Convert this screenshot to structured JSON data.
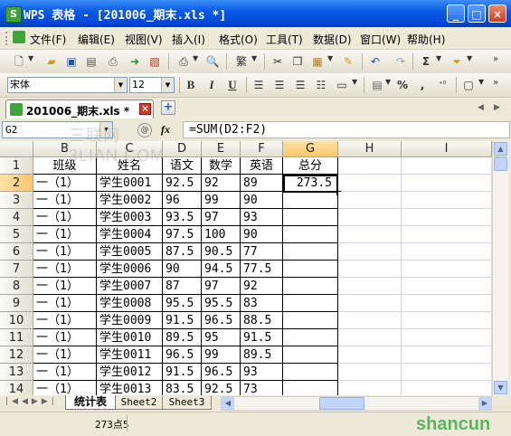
{
  "window": {
    "app_icon": "S",
    "title": "WPS 表格 - [201006_期末.xls *]",
    "min_icon": "_",
    "max_icon": "□",
    "close_icon": "×"
  },
  "menu": {
    "items": [
      "文件(F)",
      "编辑(E)",
      "视图(V)",
      "插入(I)",
      "格式(O)",
      "工具(T)",
      "数据(D)",
      "窗口(W)",
      "帮助(H)"
    ]
  },
  "format_toolbar": {
    "font_name": "宋体",
    "font_size": "12",
    "bold": "B",
    "italic": "I",
    "underline": "U",
    "percent": "%",
    "thousands": ","
  },
  "file_tab": {
    "label": "201006_期末.xls *",
    "add_label": "+"
  },
  "formula_bar": {
    "name_box": "G2",
    "fx": "fx",
    "formula": "=SUM(D2:F2)"
  },
  "columns": [
    "B",
    "C",
    "D",
    "E",
    "F",
    "G",
    "H",
    "I"
  ],
  "rows": [
    {
      "n": "1",
      "b": "班级",
      "c": "姓名",
      "d": "语文",
      "e": "数学",
      "f": "英语",
      "g": "总分"
    },
    {
      "n": "2",
      "b": "一（1）",
      "c": "学生0001",
      "d": "92.5",
      "e": "92",
      "f": "89",
      "g": "273.5"
    },
    {
      "n": "3",
      "b": "一（1）",
      "c": "学生0002",
      "d": "96",
      "e": "99",
      "f": "90",
      "g": ""
    },
    {
      "n": "4",
      "b": "一（1）",
      "c": "学生0003",
      "d": "93.5",
      "e": "97",
      "f": "93",
      "g": ""
    },
    {
      "n": "5",
      "b": "一（1）",
      "c": "学生0004",
      "d": "97.5",
      "e": "100",
      "f": "90",
      "g": ""
    },
    {
      "n": "6",
      "b": "一（1）",
      "c": "学生0005",
      "d": "87.5",
      "e": "90.5",
      "f": "77",
      "g": ""
    },
    {
      "n": "7",
      "b": "一（1）",
      "c": "学生0006",
      "d": "90",
      "e": "94.5",
      "f": "77.5",
      "g": ""
    },
    {
      "n": "8",
      "b": "一（1）",
      "c": "学生0007",
      "d": "87",
      "e": "97",
      "f": "92",
      "g": ""
    },
    {
      "n": "9",
      "b": "一（1）",
      "c": "学生0008",
      "d": "95.5",
      "e": "95.5",
      "f": "83",
      "g": ""
    },
    {
      "n": "10",
      "b": "一（1）",
      "c": "学生0009",
      "d": "91.5",
      "e": "96.5",
      "f": "88.5",
      "g": ""
    },
    {
      "n": "11",
      "b": "一（1）",
      "c": "学生0010",
      "d": "89.5",
      "e": "95",
      "f": "91.5",
      "g": ""
    },
    {
      "n": "12",
      "b": "一（1）",
      "c": "学生0011",
      "d": "96.5",
      "e": "99",
      "f": "89.5",
      "g": ""
    },
    {
      "n": "13",
      "b": "一（1）",
      "c": "学生0012",
      "d": "91.5",
      "e": "96.5",
      "f": "93",
      "g": ""
    },
    {
      "n": "14",
      "b": "一（1）",
      "c": "学生0013",
      "d": "83.5",
      "e": "92.5",
      "f": "73",
      "g": ""
    }
  ],
  "sheet_tabs": [
    "统计表",
    "Sheet2",
    "Sheet3"
  ],
  "status": {
    "text": "273点5"
  },
  "colors": {
    "title_bar": "#0a5ce6",
    "selected_header": "#f9c76b"
  }
}
